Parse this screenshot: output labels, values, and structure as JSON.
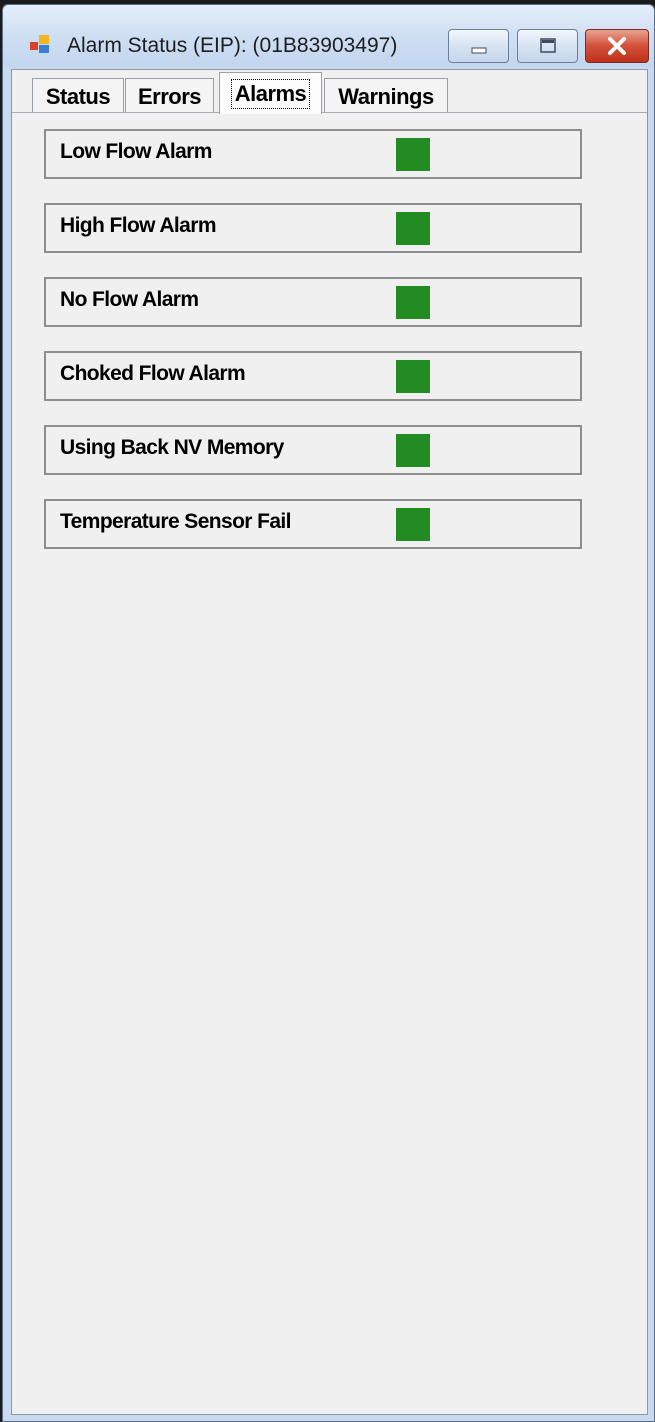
{
  "window": {
    "title": "Alarm Status (EIP): (01B83903497)"
  },
  "tabs": [
    {
      "label": "Status",
      "active": false
    },
    {
      "label": "Errors",
      "active": false
    },
    {
      "label": "Alarms",
      "active": true
    },
    {
      "label": "Warnings",
      "active": false
    }
  ],
  "alarms": [
    {
      "label": "Low Flow Alarm",
      "status_color": "#228b22"
    },
    {
      "label": "High Flow Alarm",
      "status_color": "#228b22"
    },
    {
      "label": "No Flow Alarm",
      "status_color": "#228b22"
    },
    {
      "label": "Choked Flow Alarm",
      "status_color": "#228b22"
    },
    {
      "label": "Using Back NV Memory",
      "status_color": "#228b22"
    },
    {
      "label": "Temperature Sensor Fail",
      "status_color": "#228b22"
    }
  ],
  "icons": {
    "app": "app-window-icon",
    "minimize": "minimize-icon",
    "maximize": "maximize-icon",
    "close": "close-icon"
  }
}
